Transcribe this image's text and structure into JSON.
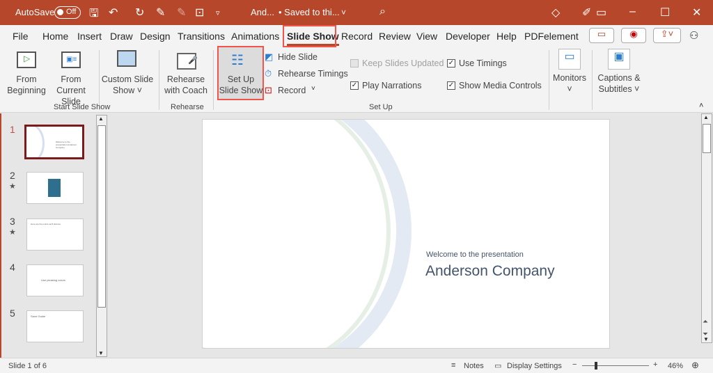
{
  "titlebar": {
    "autosave": "AutoSave",
    "toggle": "Off",
    "doc": "And...",
    "saved": "• Saved to thi...",
    "accent": "#b7472a"
  },
  "tabs": [
    "File",
    "Home",
    "Insert",
    "Draw",
    "Design",
    "Transitions",
    "Animations",
    "Slide Show",
    "Record",
    "Review",
    "View",
    "Developer",
    "Help",
    "PDFelement"
  ],
  "ribbon": {
    "from_beginning": [
      "From",
      "Beginning"
    ],
    "from_current": [
      "From",
      "Current Slide"
    ],
    "custom": [
      "Custom Slide",
      "Show ˅"
    ],
    "group_start": "Start Slide Show",
    "rehearse_coach": [
      "Rehearse",
      "with Coach"
    ],
    "group_rehearse": "Rehearse",
    "setup": [
      "Set Up",
      "Slide Show"
    ],
    "hide_slide": "Hide Slide",
    "rehearse_timings": "Rehearse Timings",
    "record": "Record",
    "keep_updated": "Keep Slides Updated",
    "play_narrations": "Play Narrations",
    "use_timings": "Use Timings",
    "show_media": "Show Media Controls",
    "group_setup": "Set Up",
    "monitors": "Monitors",
    "captions": [
      "Captions &",
      "Subtitles ˅"
    ]
  },
  "thumbs": [
    {
      "num": "1",
      "text": "Welcome to the presentation Anderson Company"
    },
    {
      "num": "2",
      "text": ""
    },
    {
      "num": "3",
      "text": "Here are the points we'll discuss"
    },
    {
      "num": "4",
      "text": "Use pleasing colors"
    },
    {
      "num": "5",
      "text": "Sand Guide"
    }
  ],
  "slide": {
    "subtitle": "Welcome to the presentation",
    "title": "Anderson Company"
  },
  "status": {
    "slide": "Slide 1 of 6",
    "notes": "Notes",
    "display": "Display Settings",
    "zoom": "46%"
  }
}
